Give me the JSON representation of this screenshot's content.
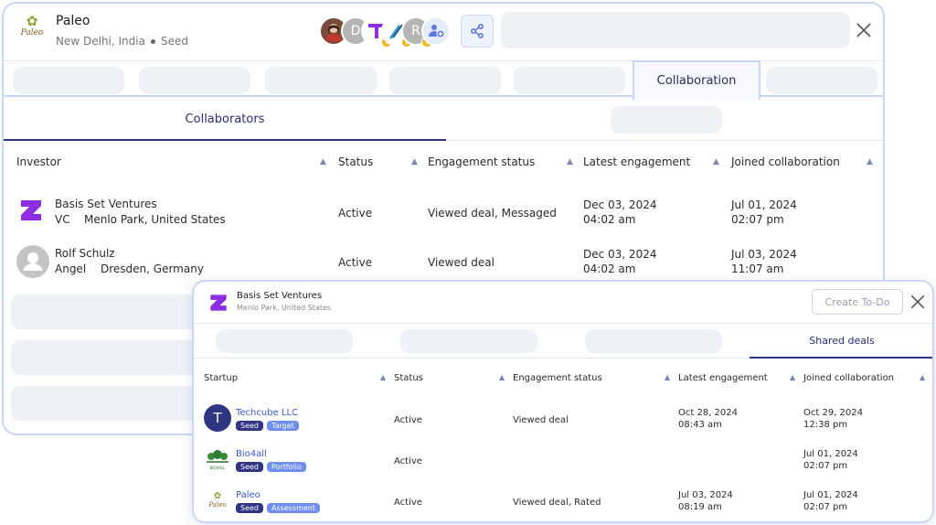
{
  "company": {
    "name": "Paleo",
    "logo_text": "Paleo",
    "location": "New Delhi, India",
    "stage": "Seed"
  },
  "main_tabs": {
    "active": "Collaboration"
  },
  "sub_tabs": {
    "active": "Collaborators"
  },
  "investors_table": {
    "headers": [
      "Investor",
      "Status",
      "Engagement status",
      "Latest engagement",
      "Joined collaboration"
    ],
    "rows": [
      {
        "name": "Basis Set Ventures",
        "type": "VC",
        "location": "Menlo Park, United States",
        "status": "Active",
        "engagement": "Viewed deal, Messaged",
        "latest_date": "Dec 03, 2024",
        "latest_time": "04:02 am",
        "joined_date": "Jul 01, 2024",
        "joined_time": "02:07 pm"
      },
      {
        "name": "Rolf Schulz",
        "type": "Angel",
        "location": "Dresden, Germany",
        "status": "Active",
        "engagement": "Viewed deal",
        "latest_date": "Dec 03, 2024",
        "latest_time": "04:02 am",
        "joined_date": "Jul 03, 2024",
        "joined_time": "11:07 am"
      }
    ]
  },
  "popup": {
    "name": "Basis Set Ventures",
    "location": "Menlo Park, United States",
    "create_todo": "Create To-Do",
    "active_tab": "Shared deals",
    "headers": [
      "Startup",
      "Status",
      "Engagement status",
      "Latest engagement",
      "Joined collaboration"
    ],
    "rows": [
      {
        "name": "Techcube LLC",
        "icon_letter": "T",
        "tags": [
          "Seed",
          "Target"
        ],
        "status": "Active",
        "engagement": "Viewed deal",
        "latest_date": "Oct 28, 2024",
        "latest_time": "08:43 am",
        "joined_date": "Oct 29, 2024",
        "joined_time": "12:38 pm"
      },
      {
        "name": "Bio4all",
        "icon_text": "BIO4ALL",
        "tags": [
          "Seed",
          "Portfolio"
        ],
        "status": "Active",
        "engagement": "",
        "latest_date": "",
        "latest_time": "",
        "joined_date": "Jul 01, 2024",
        "joined_time": "02:07 pm"
      },
      {
        "name": "Paleo",
        "icon_text": "Paleo",
        "tags": [
          "Seed",
          "Assessment"
        ],
        "status": "Active",
        "engagement": "Viewed deal, Rated",
        "latest_date": "Jul 03, 2024",
        "latest_time": "08:19 am",
        "joined_date": "Jul 01, 2024",
        "joined_time": "02:07 pm"
      }
    ]
  },
  "colors": {
    "accent": "#2f3580",
    "link": "#3b57d6",
    "active_status": "#2ea84d",
    "border": "#c9d6f5",
    "placeholder": "#eef1f6"
  },
  "icons": [
    "share-icon",
    "close-icon",
    "sort-icon",
    "add-user-icon",
    "person-icon"
  ]
}
